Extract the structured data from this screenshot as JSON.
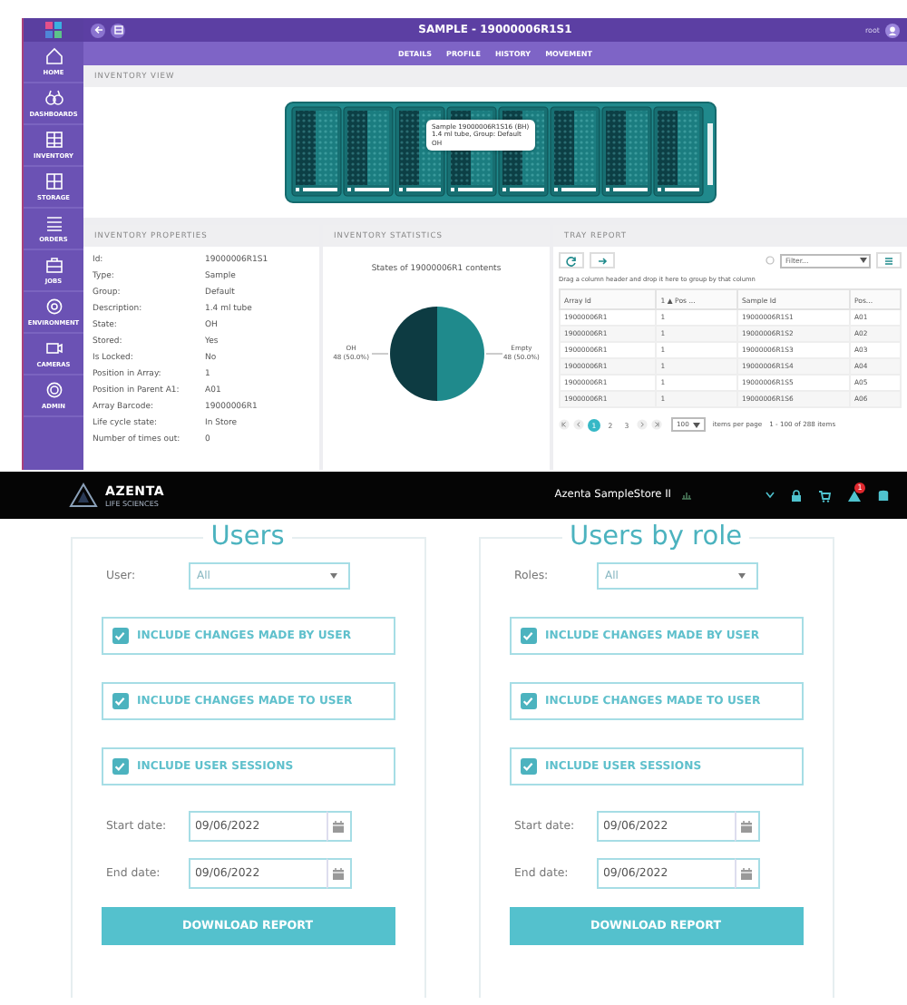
{
  "inventory_app": {
    "sidebar": [
      {
        "label": "HOME"
      },
      {
        "label": "DASHBOARDS"
      },
      {
        "label": "INVENTORY"
      },
      {
        "label": "STORAGE"
      },
      {
        "label": "ORDERS"
      },
      {
        "label": "JOBS"
      },
      {
        "label": "ENVIRONMENT"
      },
      {
        "label": "CAMERAS"
      },
      {
        "label": "ADMIN"
      }
    ],
    "window": {
      "title": "SAMPLE - 19000006R1S1",
      "user": "root"
    },
    "tabs": [
      {
        "label": "DETAILS"
      },
      {
        "label": "PROFILE"
      },
      {
        "label": "HISTORY"
      },
      {
        "label": "MOVEMENT"
      }
    ],
    "inventory_view": {
      "title": "INVENTORY VIEW",
      "tooltip": [
        "Sample 19000006R1S16 (BH)",
        "1.4 ml tube, Group: Default",
        "OH"
      ]
    },
    "properties": {
      "title": "INVENTORY PROPERTIES",
      "rows": [
        {
          "label": "Id:",
          "value": "19000006R1S1"
        },
        {
          "label": "Type:",
          "value": "Sample"
        },
        {
          "label": "Group:",
          "value": "Default"
        },
        {
          "label": "Description:",
          "value": "1.4 ml tube"
        },
        {
          "label": "State:",
          "value": "OH"
        },
        {
          "label": "Stored:",
          "value": "Yes"
        },
        {
          "label": "Is Locked:",
          "value": "No"
        },
        {
          "label": "Position in Array:",
          "value": "1"
        },
        {
          "label": "Position in Parent A1:",
          "value": "A01"
        },
        {
          "label": "Array Barcode:",
          "value": "19000006R1"
        },
        {
          "label": "Life cycle state:",
          "value": "In Store"
        },
        {
          "label": "Number of times out:",
          "value": "0"
        }
      ]
    },
    "statistics": {
      "title": "INVENTORY STATISTICS",
      "chart_data": {
        "type": "pie",
        "title": "States of 19000006R1 contents",
        "categories": [
          "OH",
          "Empty"
        ],
        "values": [
          50,
          50
        ],
        "value_labels": [
          "48 (50.0%)",
          "48 (50.0%)"
        ]
      }
    },
    "tray_report": {
      "title": "TRAY REPORT",
      "filter": {
        "placeholder": "Filter..."
      },
      "group_hint": "Drag a column header and drop it here to group by that column",
      "columns": [
        "Array Id",
        "1 ▲ Pos ...",
        "Sample Id",
        "Pos..."
      ],
      "rows": [
        [
          "19000006R1",
          "1",
          "19000006R1S1",
          "A01"
        ],
        [
          "19000006R1",
          "1",
          "19000006R1S2",
          "A02"
        ],
        [
          "19000006R1",
          "1",
          "19000006R1S3",
          "A03"
        ],
        [
          "19000006R1",
          "1",
          "19000006R1S4",
          "A04"
        ],
        [
          "19000006R1",
          "1",
          "19000006R1S5",
          "A05"
        ],
        [
          "19000006R1",
          "1",
          "19000006R1S6",
          "A06"
        ]
      ],
      "pager": {
        "pages": [
          {
            "label": "1",
            "selected": true
          },
          {
            "label": "2",
            "selected": false
          },
          {
            "label": "3",
            "selected": false
          }
        ],
        "page_size": "100",
        "page_size_label": "items per page",
        "summary": "1 - 100 of 288 items"
      }
    }
  },
  "report_app": {
    "brand": "AZENTA",
    "brand_sub": "LIFE SCIENCES",
    "title": "Azenta SampleStore II",
    "notification_count": "1",
    "cards": [
      {
        "title": "Users",
        "select": {
          "label": "User:",
          "value": "All"
        },
        "options": [
          {
            "label": "INCLUDE CHANGES MADE BY USER",
            "checked": true
          },
          {
            "label": "INCLUDE CHANGES MADE TO USER",
            "checked": true
          },
          {
            "label": "INCLUDE USER SESSIONS",
            "checked": true
          }
        ],
        "dates": [
          {
            "label": "Start date:",
            "value": "09/06/2022"
          },
          {
            "label": "End date:",
            "value": "09/06/2022"
          }
        ],
        "button": "DOWNLOAD REPORT"
      },
      {
        "title": "Users by role",
        "select": {
          "label": "Roles:",
          "value": "All"
        },
        "options": [
          {
            "label": "INCLUDE CHANGES MADE BY USER",
            "checked": true
          },
          {
            "label": "INCLUDE CHANGES MADE TO USER",
            "checked": true
          },
          {
            "label": "INCLUDE USER SESSIONS",
            "checked": true
          }
        ],
        "dates": [
          {
            "label": "Start date:",
            "value": "09/06/2022"
          },
          {
            "label": "End date:",
            "value": "09/06/2022"
          }
        ],
        "button": "DOWNLOAD REPORT"
      }
    ]
  }
}
